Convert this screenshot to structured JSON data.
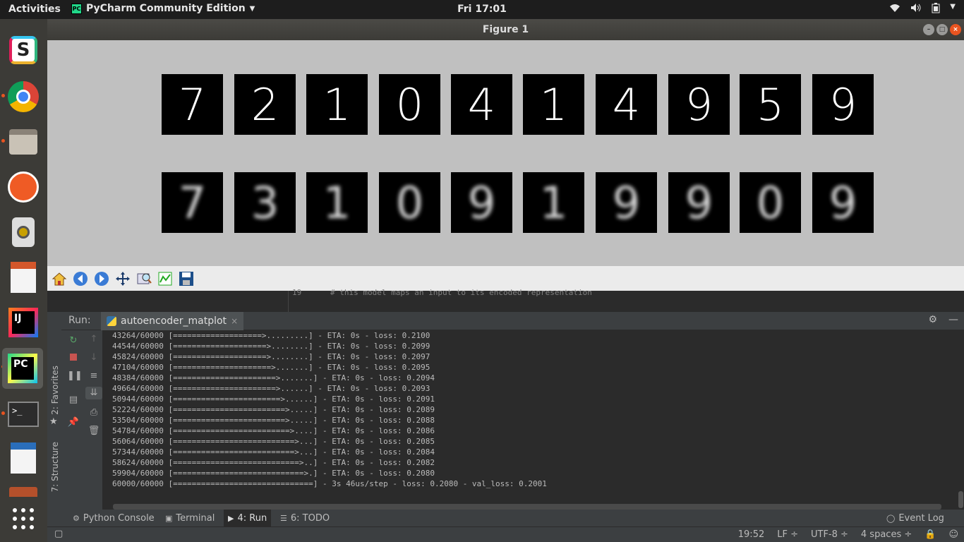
{
  "topbar": {
    "activities": "Activities",
    "app_name": "PyCharm Community Edition",
    "app_icon_text": "PC",
    "clock": "Fri 17:01"
  },
  "dock": {
    "items": [
      "slack-icon",
      "chrome-icon",
      "files-icon",
      "postman-icon",
      "speaker-icon",
      "impress-icon",
      "intellij-icon",
      "pycharm-icon",
      "terminal-icon",
      "writer-icon",
      "files2-icon",
      "app-grid-icon"
    ],
    "intellij_text": "IJ",
    "pycharm_text": "PC",
    "slack_text": "S"
  },
  "figure": {
    "title": "Figure 1",
    "top_row_digits": [
      "7",
      "2",
      "1",
      "0",
      "4",
      "1",
      "4",
      "9",
      "5",
      "9"
    ],
    "bottom_row_digits": [
      "7",
      "3",
      "1",
      "0",
      "9",
      "1",
      "9",
      "9",
      "0",
      "9"
    ],
    "toolbar": [
      "home-icon",
      "back-icon",
      "forward-icon",
      "pan-icon",
      "zoom-icon",
      "subplots-icon",
      "save-icon"
    ]
  },
  "editor": {
    "line_number": "19",
    "code": "# this model maps an input to its encoded representation"
  },
  "run": {
    "label": "Run:",
    "tab": "autoencoder_matplot",
    "tab_close": "×"
  },
  "left_strip": {
    "favorites": "2: Favorites",
    "structure": "7: Structure"
  },
  "console": {
    "lines": [
      "43264/60000 [===================>.........] - ETA: 0s - loss: 0.2100",
      "44544/60000 [====================>........] - ETA: 0s - loss: 0.2099",
      "45824/60000 [====================>........] - ETA: 0s - loss: 0.2097",
      "47104/60000 [=====================>.......] - ETA: 0s - loss: 0.2095",
      "48384/60000 [======================>.......] - ETA: 0s - loss: 0.2094",
      "49664/60000 [======================>......] - ETA: 0s - loss: 0.2093",
      "50944/60000 [=======================>......] - ETA: 0s - loss: 0.2091",
      "52224/60000 [========================>.....] - ETA: 0s - loss: 0.2089",
      "53504/60000 [========================>.....] - ETA: 0s - loss: 0.2088",
      "54784/60000 [=========================>....] - ETA: 0s - loss: 0.2086",
      "56064/60000 [==========================>...] - ETA: 0s - loss: 0.2085",
      "57344/60000 [==========================>...] - ETA: 0s - loss: 0.2084",
      "58624/60000 [===========================>..] - ETA: 0s - loss: 0.2082",
      "59904/60000 [============================>.] - ETA: 0s - loss: 0.2080",
      "60000/60000 [==============================] - 3s 46us/step - loss: 0.2080 - val_loss: 0.2001"
    ]
  },
  "bottom_tabs": {
    "python_console": "Python Console",
    "terminal": "Terminal",
    "run": "4: Run",
    "todo": "6: TODO",
    "event_log": "Event Log"
  },
  "status": {
    "position": "19:52",
    "line_sep": "LF ÷",
    "encoding": "UTF-8 ÷",
    "indent": "4 spaces ÷"
  },
  "colors": {
    "accent_pycharm": "#21d789",
    "ubuntu_orange": "#e95420",
    "figure_bg": "#c0c0c0"
  }
}
